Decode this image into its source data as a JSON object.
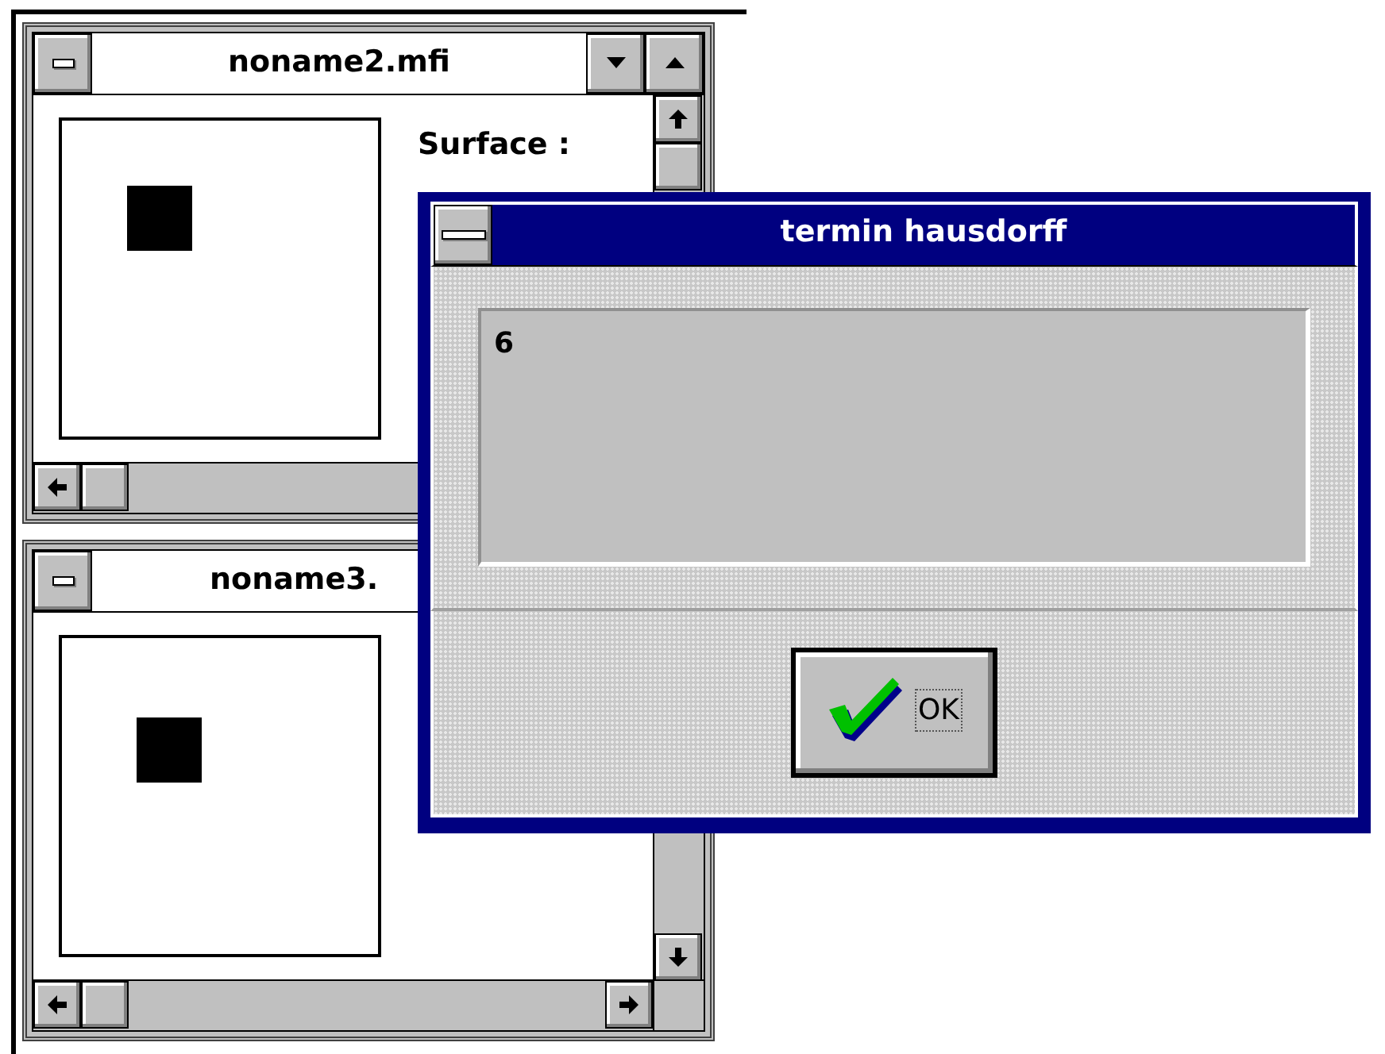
{
  "windows": [
    {
      "title": "noname2.mfi",
      "label": "Surface :"
    },
    {
      "title": "noname3."
    }
  ],
  "dialog": {
    "title": "termin hausdorff",
    "message": "6",
    "button": "OK"
  }
}
